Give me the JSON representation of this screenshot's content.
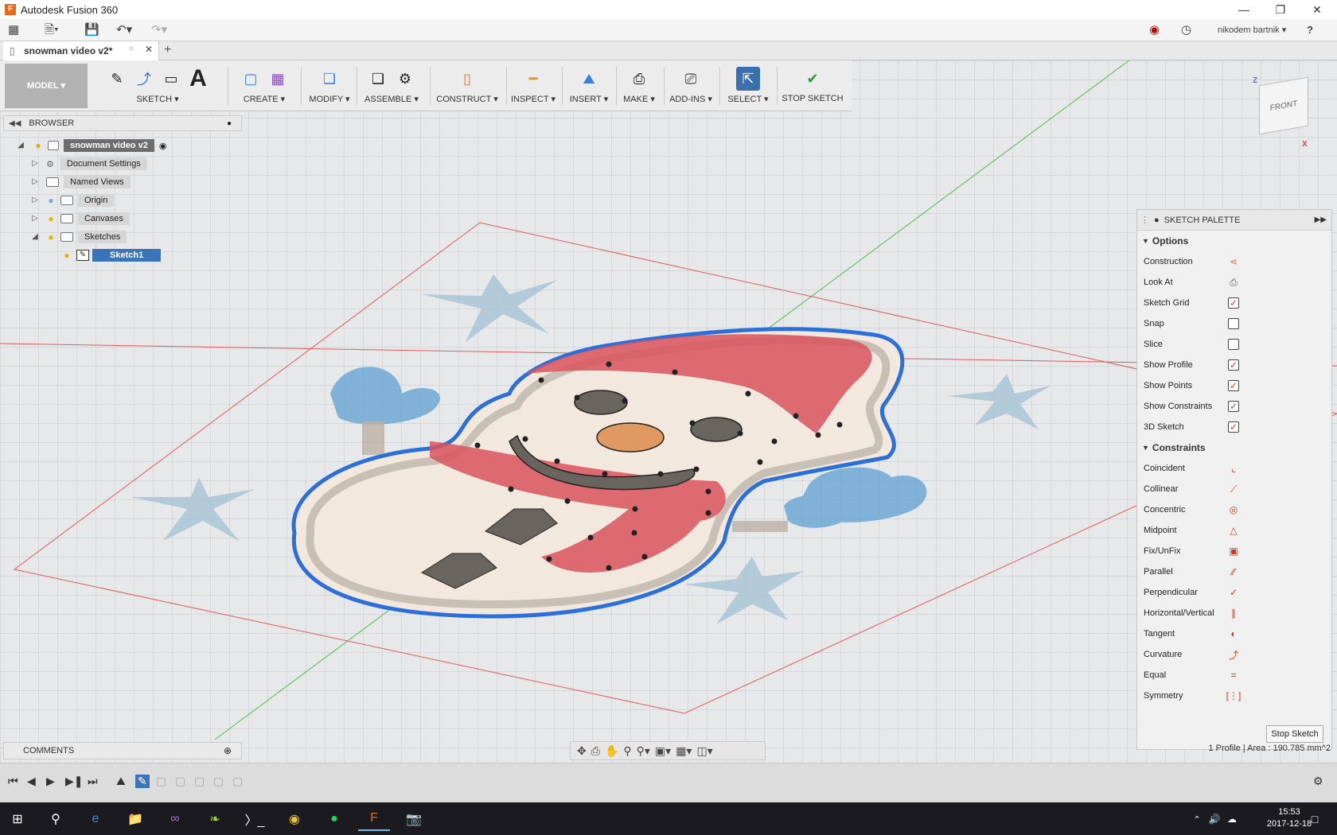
{
  "window": {
    "title": "Autodesk Fusion 360",
    "app_icon_letter": "F"
  },
  "quick_access": {
    "user_name": "nikodem bartnik ▾",
    "help": "?"
  },
  "document_tab": {
    "name": "snowman video v2*"
  },
  "toolbar": {
    "workspace": "MODEL ▾",
    "groups": [
      {
        "label": "SKETCH ▾"
      },
      {
        "label": "CREATE ▾"
      },
      {
        "label": "MODIFY ▾"
      },
      {
        "label": "ASSEMBLE ▾"
      },
      {
        "label": "CONSTRUCT ▾"
      },
      {
        "label": "INSPECT ▾"
      },
      {
        "label": "INSERT ▾"
      },
      {
        "label": "MAKE ▾"
      },
      {
        "label": "ADD-INS ▾"
      },
      {
        "label": "SELECT ▾"
      },
      {
        "label": "STOP SKETCH"
      }
    ]
  },
  "browser": {
    "title": "BROWSER",
    "root": "snowman video v2",
    "items": [
      {
        "label": "Document Settings"
      },
      {
        "label": "Named Views"
      },
      {
        "label": "Origin"
      },
      {
        "label": "Canvases"
      },
      {
        "label": "Sketches"
      },
      {
        "label": "Sketch1"
      }
    ]
  },
  "viewcube": {
    "face": "FRONT",
    "axis_z": "Z",
    "axis_x": "X"
  },
  "palette": {
    "title": "SKETCH PALETTE",
    "options_header": "Options",
    "options": [
      {
        "label": "Construction",
        "control": "icon"
      },
      {
        "label": "Look At",
        "control": "icon"
      },
      {
        "label": "Sketch Grid",
        "checked": true
      },
      {
        "label": "Snap",
        "checked": false
      },
      {
        "label": "Slice",
        "checked": false
      },
      {
        "label": "Show Profile",
        "checked": true
      },
      {
        "label": "Show Points",
        "checked": true
      },
      {
        "label": "Show Constraints",
        "checked": true
      },
      {
        "label": "3D Sketch",
        "checked": true
      }
    ],
    "constraints_header": "Constraints",
    "constraints": [
      {
        "label": "Coincident"
      },
      {
        "label": "Collinear"
      },
      {
        "label": "Concentric"
      },
      {
        "label": "Midpoint"
      },
      {
        "label": "Fix/UnFix"
      },
      {
        "label": "Parallel"
      },
      {
        "label": "Perpendicular"
      },
      {
        "label": "Horizontal/Vertical"
      },
      {
        "label": "Tangent"
      },
      {
        "label": "Curvature"
      },
      {
        "label": "Equal"
      },
      {
        "label": "Symmetry"
      }
    ],
    "stop_button": "Stop Sketch"
  },
  "comments": {
    "title": "COMMENTS"
  },
  "status_text": "1 Profile | Area : 190.785 mm^2",
  "taskbar": {
    "time": "15:53",
    "date": "2017-12-18"
  },
  "colors": {
    "accent": "#2f6fb5",
    "hat": "#d9545e",
    "body": "#f4ede4",
    "outline": "#2c6fd8",
    "mitten": "#5e9fd0"
  }
}
